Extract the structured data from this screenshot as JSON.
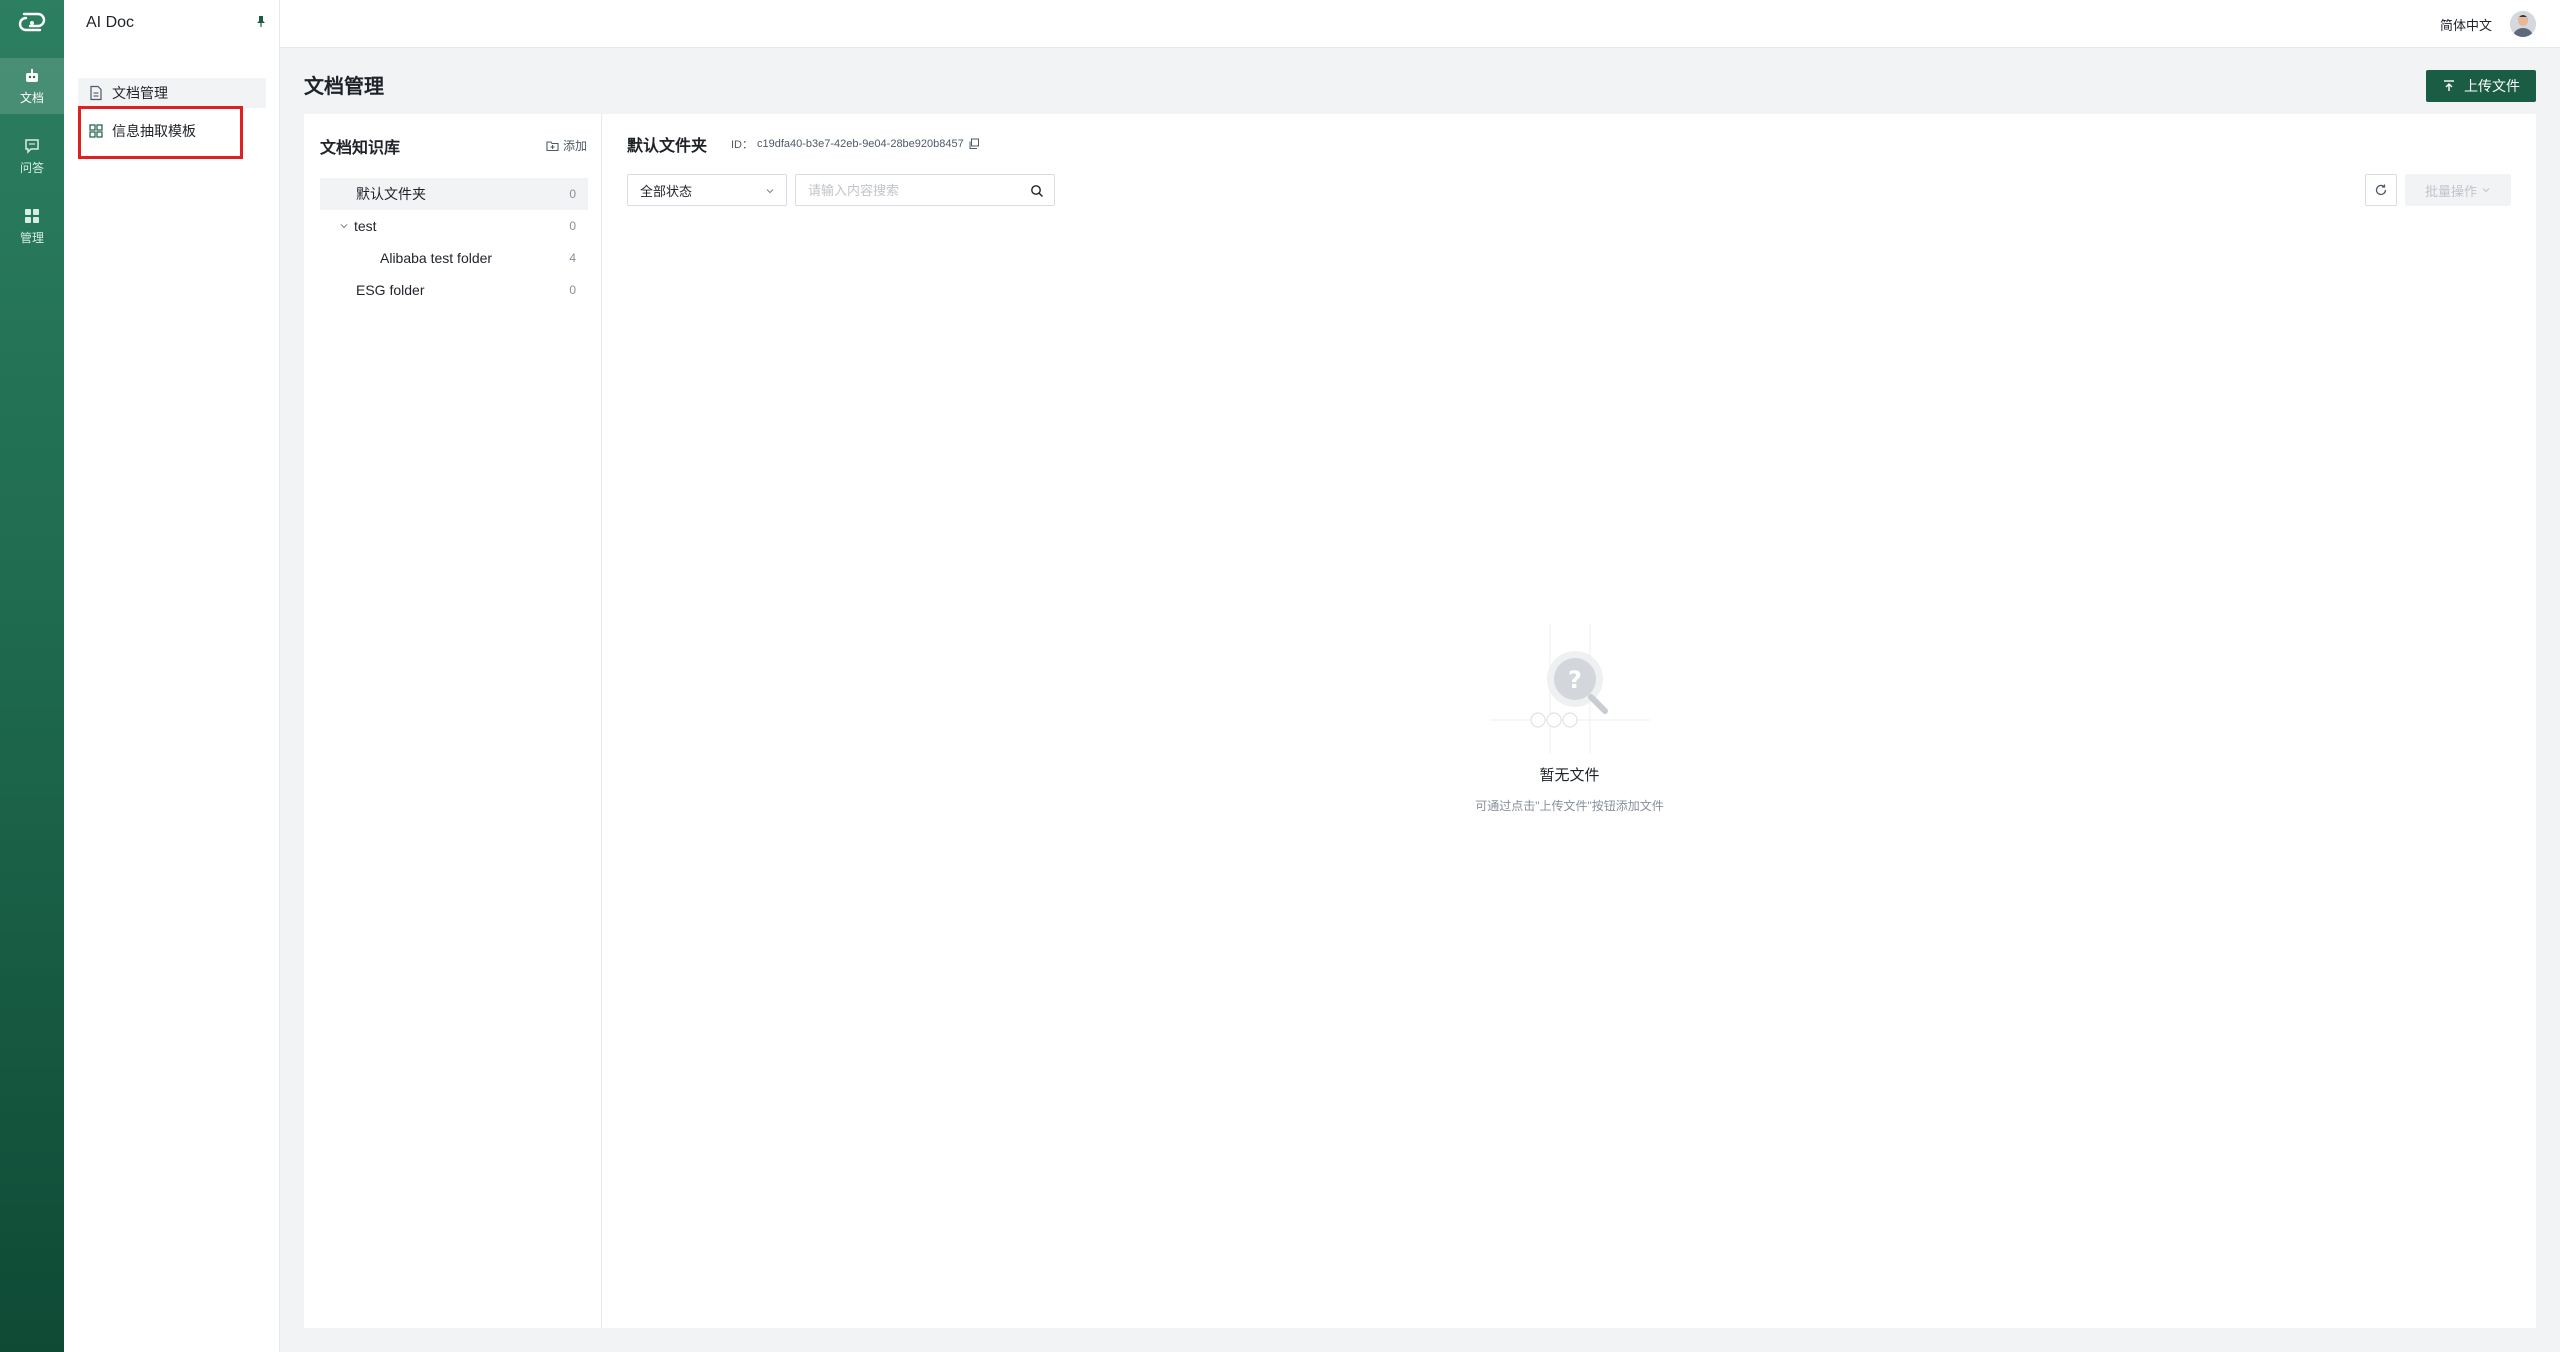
{
  "app": {
    "title": "AI Doc"
  },
  "rail": {
    "items": [
      {
        "label": "文档",
        "icon": "robot-icon",
        "active": true
      },
      {
        "label": "问答",
        "icon": "chat-icon",
        "active": false
      },
      {
        "label": "管理",
        "icon": "grid-icon",
        "active": false
      }
    ]
  },
  "sidebar": {
    "items": [
      {
        "label": "文档管理",
        "icon": "document-icon",
        "active": true
      },
      {
        "label": "信息抽取模板",
        "icon": "template-grid-icon",
        "active": false
      }
    ]
  },
  "topbar": {
    "language": "简体中文"
  },
  "main": {
    "title": "文档管理",
    "upload_label": "上传文件"
  },
  "tree": {
    "title": "文档知识库",
    "add_label": "添加",
    "nodes": [
      {
        "label": "默认文件夹",
        "count": "0",
        "level": 0,
        "active": true,
        "expandable": false
      },
      {
        "label": "test",
        "count": "0",
        "level": 0,
        "active": false,
        "expandable": true
      },
      {
        "label": "Alibaba test folder",
        "count": "4",
        "level": 1,
        "active": false,
        "expandable": false
      },
      {
        "label": "ESG folder",
        "count": "0",
        "level": 0,
        "active": false,
        "expandable": false
      }
    ]
  },
  "files": {
    "folder_name": "默认文件夹",
    "folder_id_label": "ID：",
    "folder_id": "c19dfa40-b3e7-42eb-9e04-28be920b8457",
    "status_filter": "全部状态",
    "search_placeholder": "请输入内容搜索",
    "batch_label": "批量操作",
    "empty_title": "暂无文件",
    "empty_hint": "可通过点击\"上传文件\"按钮添加文件"
  },
  "colors": {
    "brand": "#1a5c44",
    "rail_top": "#2d7f61",
    "rail_bottom": "#0f4a35",
    "highlight": "#e02020"
  }
}
